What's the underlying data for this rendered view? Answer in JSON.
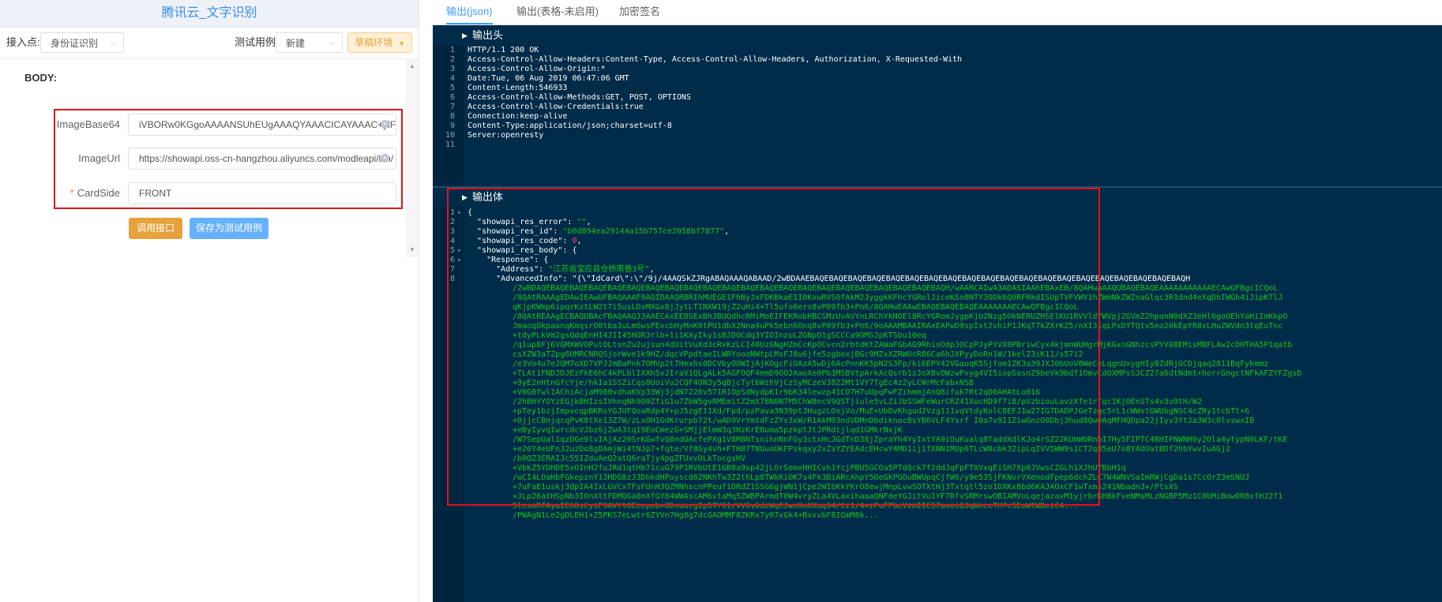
{
  "left": {
    "title": "腾讯云_文字识别",
    "access_point_label": "接入点:",
    "access_point_value": "身份证识别",
    "test_case_label": "测试用例:",
    "test_case_value": "新建",
    "env_button": "草稿环境",
    "body_label": "BODY:",
    "fields": [
      {
        "label": "ImageBase64",
        "value": "iVBORw0KGgoAAAANSUhEUgAAAQYAAACICAYAAAC+ylF",
        "required": false
      },
      {
        "label": "ImageUrl",
        "value": "https://showapi.oss-cn-hangzhou.aliyuncs.com/modleapi/lzh/",
        "required": false
      },
      {
        "label": "CardSide",
        "value": "FRONT",
        "required": true
      }
    ],
    "call_button": "调用接口",
    "save_button": "保存为测试用例"
  },
  "right": {
    "tabs": [
      "输出(json)",
      "输出(表格-未启用)",
      "加密签名"
    ],
    "header_section": "输出头",
    "body_section": "输出体",
    "header_lines": [
      "HTTP/1.1 200 OK",
      "Access-Control-Allow-Headers:Content-Type, Access-Control-Allow-Headers, Authorization, X-Requested-With",
      "Access-Control-Allow-Origin:*",
      "Date:Tue, 06 Aug 2019 06:47:06 GMT",
      "Content-Length:546933",
      "Access-Control-Allow-Methods:GET, POST, OPTIONS",
      "Access-Control-Allow-Credentials:true",
      "Connection:keep-alive",
      "Content-Type:application/json;charset=utf-8",
      "Server:openresty",
      ""
    ],
    "body_lines": [
      "{",
      "  \"showapi_res_error\": \"\",",
      "  \"showapi_res_id\": \"b0d894ea29144a15b757ce2058bf7877\",",
      "  \"showapi_res_code\": 0,",
      "  \"showapi_res_body\": {",
      "    \"Response\": {",
      "      \"Address\": \"江苏省宝应县仓桥南巷3号\",",
      "      \"AdvancedInfo\": \"{\\\"IdCard\\\":\\\"/9j/4AAQSkZJRgABAQAAAQABAAD/2wBDAAEBAQEBAQEBAQEBAQEBAQEBAQEBAQEBAQEBAQEBAQEBAQEBAQEBAQEBAQEBAQEBAQEBAQEBAQEBAQEBAQH"
    ],
    "body_fold_lines": [
      1,
      5,
      6
    ],
    "wrapped_lines": [
      "/2wBDAQEBAQEBAQEBAQEBAQEBAQEBAQEBAQEBAQEBAQEBAQEBAQEBAQEBAQEBAQEBAQEBAQEBAQEBAQEBAQEBAQEBAQH/wAARCAIwA3ADASIAAhEBAxEB/8QAHwAAAQUBAQEBAQEAAAAAAAAAAAECAwQFBgcICQoL",
      "/8QAtRAAAgEDAwIEAwUFBAQAAAF9AQIDAAQRBRIhMUEGE1FhByJxFDKBkaEII0KxwRVS0fAkM2JyggkKFhcYGRolJicoKSo0NTY3ODk6Q0RFRkdISUpTVFVWV1hZWmNkZWZnaGlqc3R1dnd4eXqDhIWGh4iJipKTlJ",
      "qKjpKWmp6ipqrKztLW2t7i5usLDxMXGx8jJytLT1NXW19jZ2uHi4+Tl5ufo6erx8vP09fb3+Pn6/8QAHwEAAwEBAQEBAQEBAQEAAAAAAAECAwQFBgcICQoL",
      "/8QAtREAAgECBAQDBAcFBAQAAQJ3AAECAxEEBSExBhJBUQdhcRMiMoEIFEKRobHBCSMzUvAVYnLRChYkNOEl8RcYGRomJygpKjU2Nzg5OkNERUZHSElKU1RVVldYWVpjZGVmZ2hpanN0dXZ3eHl6goOEhYaHiImKkpO",
      "JmaoqOkpaanqKmqsrO0tba3uLm6wsPExcbHyMnK0tPU1dbX2Nna4uPk5ebn6Onq8vP09fb3+Pn6/9oAAAMBAAIRAxEAPwD9spIxt2vhiP1JKqT7kZXrKZ5/nXI31qLPxDYTQtv5eo20kEpYR8xLHuZWVdn3tqEuTnc",
      "+tdyPLkVm2gsQdqEnHI4JII45HOR3rlb+1i1KXyIky1sBJDOCdq3YIOInzuLZGNpO1gSCCCa9OMSJpKTSbu10eq",
      "/q1up8Fj6VGMXWVOPutOLtsnZu2ujsun4dUitVuXd3cRxKzLCI40UzGNgHZmCcKpOCvcn2rbtdKtZAWaFGbAG9RhioOdpJOCpPJyPYVX8PBriwCyx4kjmnWUHgrMjKGxnGNhzcsPYV08EMisMBFLAw2cDHTHA5P1qatb",
      "csXZW3aTZpg6UMRCNRQSjorWve1k9HZ/dqcVPpdtaeILWRYoooNWtpLMsFJ8u6jfe5zgboxjBGc9MZxXZRWUcR86Ca6hJXPyyDoRn1W/1kelZ3iK11/s57i2",
      "/e3Vo4u7eJQM7oXD7VPJJmBaPnk7OMVp2t7Hexhs0DCVbyOOWIjAjKOgcFiOAzA5wDj6AcPnnKK5pN2S3Fp/ki6EPY42VGauqK5Sjfom1ZK3a39JXJ0bUoV8WeCeLqgnUxygHIy8ZdRjGCDjqaq2811BqFykmmz",
      "+TLAt1FNDJDJEzFkE6hC4kPLblIXXhSvJIraV1QLgALk5AGFOQF4emD9OO2AaoXe0Pb3MSBVtpArkAcQsrb1zJoX8vOWzwPxyg4VI5iopSasnZ9beVk9bdf1OmvCdOXMPsSJCZ27a6dtNdmt+horrGngctNFkAFZYFZgsD",
      "+9yE2nHtnGfcYje/hkIa1SSZiCqs0UoiVu2CQF4ON3y5qBjcTytbWzhVjCzSyMCzeVJ822Mt1VY7TgEc4z2yLCWrMcFabxNSB",
      "+V0G0fwl1AChiAcjaM980vdhaKVp33Wj3jdN7226v571R1OpSdNydpK1r9bK34lewzp41CO7H7uUpqFwFZihmmjAnQ8ifuk7Rt2qD0AHAtLo016",
      "/2hBHYYOYzEGjkBHIzsIVhnqNh9O9ZfiG1u7ZbW5gvRMEmitZ2mX78N0N7M5ChW8ncV9QSTjiule5vLZiJbSSWFeWurCRZ41XucHD9f7i8/pVzbiouLavzXfe1rfqc1KjOEnSTs4v3u9tH/W2",
      "+pTey1bzjImpvcqpBKRsYGJUFQoaRdp4Y+pJ5zgE11Xd/Fpd/pzPava3N39ptJHugzLOxjVo/MuE+UbDvKhgud2Vzg111vqVtdyKolC8EFJ1w27IG7DADPJGeTzgc5rL1cWWvtGWUbgNSC4cZRy1tcbTt+6",
      "+0jjcCBnjqcqPvK8tXe13Z7W/zLxOH1GdKrurpb72t/wAD9VrYmtdFzZYv3xW/R1AkM03ndVDMnDbdiknacBsYB6VLF4Ysrf I0a7v9I1ZiwGnzO0Dbj3hud8QwOAqMFHQDpa22jIyv3YtJa3W3c0lvswxIB",
      "+eByIyvqIwrcdcVJbz6jZwA3tq19EoCmezG+SMjjElmW3q3HzKrE8uma5pzkptJtJPRdtjlqd1GMkrNxjK",
      "/W7SepUal1qzDGe9lvIAjAz20SrKGwfvQ8ndOAcfePXg1V8M8NTsnihnNnFGy3ctxHcJGdTnD38jZpraYh4YyIxtYA9iOuKualq8TaddXdlKJo4rSZ22KUmWURnbI7Hy5FIPTC4BHIPNWNH0y2Ola4ytypN0LKF/tKE",
      "+e26Y4eUFnJ2uzDo8gDAmjWi4tNJp7+fqte/Vf8Gy4vh+FTH87TNUuoUKFPskqxy2xZsYZYEAdcEHcwY4MD1ij1fXNN1MOp6TLcW8cbk32ipLqIVV5WW9s1CT2q85eU7o8YAOUatBDf2hbYwvIuAGj2",
      "/b0QZ3ERAIJc55IZduAeQ2atQ6raTjy4pgZFUxvDLkTocgsHV",
      "+VbkZ5YDHDE5xOInH2fuJRd1qtHb71cuG79P1RVbUtE1GB0a9sp42jLOrSomxHHICvh1YcjPBU5GCOa5PTdQck7f2ddJqFpFTXVxqEiSH7Xp0JVwsCZGLh1XJhUYBbH1q",
      "/wCI4LOaHbFGkepznY13HDG8zJ3DhkdHPuyscd62NKhTw3Z2thLp8TWkKiOK7s4Fk3BiARcAhpY5OeGkPGOuBWUpqCjfW6/y9e53SjFKNorVXenodFpep6dchZLC7W4WNVSaImRWjCgDa1s7CcOrZ3mSNUJ",
      "+7uFaE1uskj3dpIA4IxLGVCxTFsFUnH3QZMNhscnPPeuf1DRdZ1SSG6gjWN1jCpe2WIbKkYKrO8ewjMnpLvwSOTXtHj3Txtqtl5zo1DXKx8bd6KAJAOxCF1wTxms241Nbadn3+/PtsXS",
      "+JLp26atHSpNb3IOnXttFDMQGa0nXfGY84WWAscAM6vtaMq5ZWBPArmdT0W4vryZLa4VLaxihaaaQNFdeYGJitVu1YF7RfvSRMrswOBIAMVoLqejazavM1yjrbrKHBkFveNMsMLzNGBP5Mz1C0bMiBowOR8xfHJ2f1"
    ],
    "wrapped_tail": [
      "5lcsoRfAyaIE60sCyiP9AVYtOEzepxb+ODxuacgIp5TY91/VV6v6dzWqCJwcKnKXuq94/Cz1/4+zPuFPbeVzmIIC57avmiG3qWnecTHfcSEoWtWDeiC4...",
      "/PWAgN1Le2gDLEH1+Z5PKS7eLwtr6ZYVn7Hg8g7dcGAOMMF8ZKRx7y07xGk4+RvxvbF8IGmM8k..."
    ]
  }
}
